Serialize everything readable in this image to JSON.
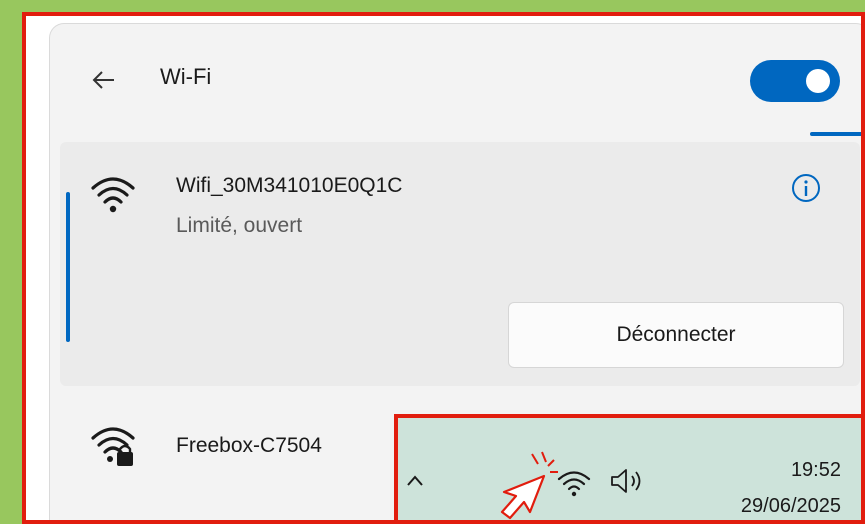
{
  "header": {
    "title": "Wi-Fi",
    "toggle_state": "on"
  },
  "networks": [
    {
      "name": "Wifi_30M341010E0Q1C",
      "status": "Limité, ouvert",
      "action_label": "Déconnecter"
    },
    {
      "name": "Freebox-C7504"
    }
  ],
  "taskbar": {
    "time": "19:52",
    "date": "29/06/2025"
  },
  "icons": {
    "back": "back-arrow-icon",
    "wifi": "wifi-icon",
    "wifi_locked": "wifi-lock-icon",
    "info": "info-icon",
    "chevron": "chevron-up-icon",
    "volume": "speaker-icon",
    "cursor": "mouse-cursor-icon"
  },
  "colors": {
    "accent": "#0067c0",
    "highlight": "#e11d0e",
    "background": "#98c75e"
  }
}
